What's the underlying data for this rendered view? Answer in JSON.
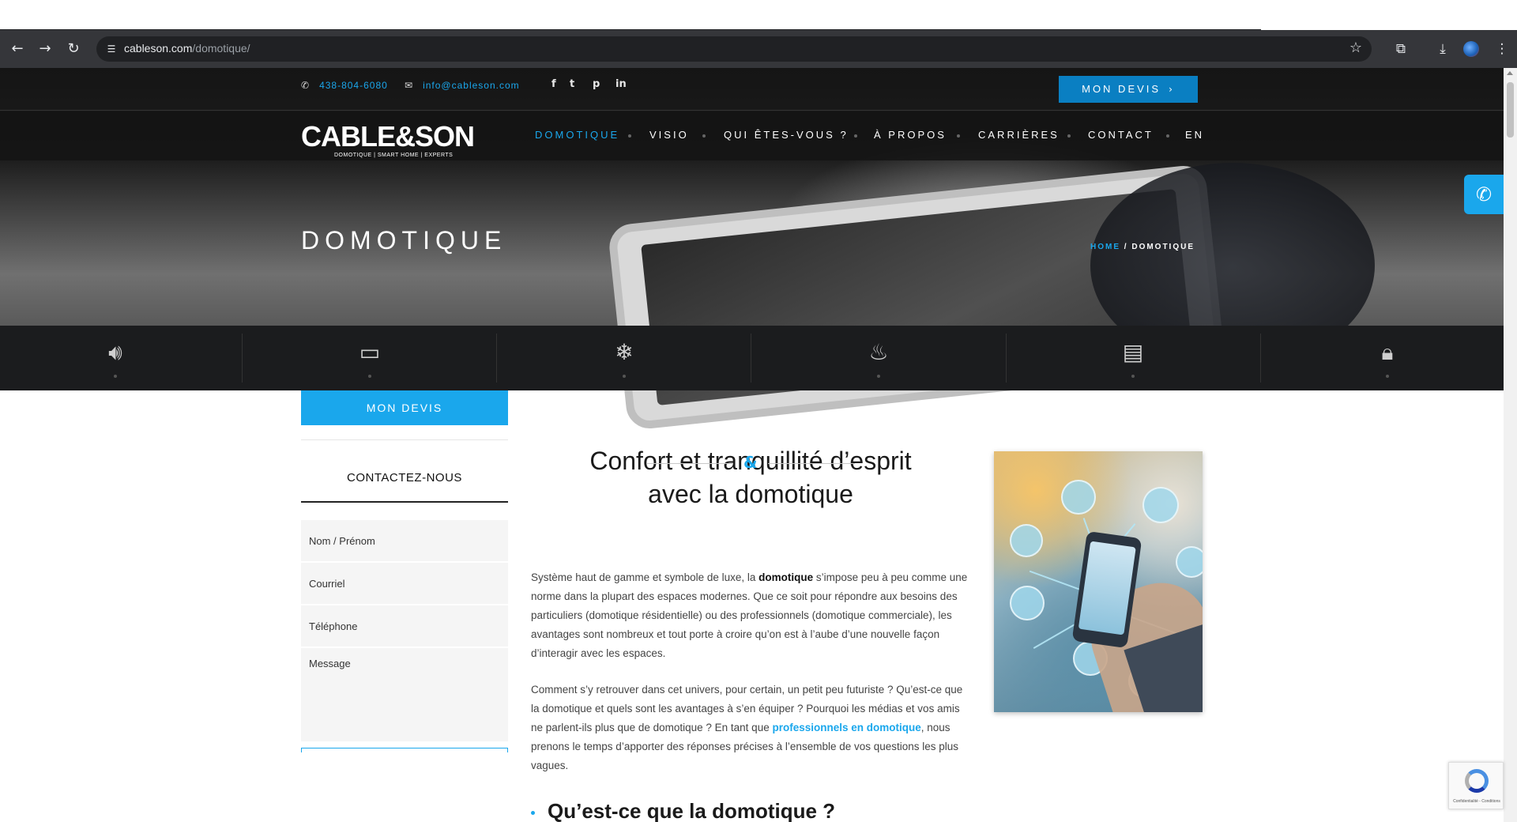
{
  "browser": {
    "url_host": "cableson.com",
    "url_path": "/domotique/"
  },
  "topbar": {
    "phone": "438-804-6080",
    "email": "info@cableson.com",
    "social": [
      "f",
      "t",
      "p",
      "in"
    ],
    "devis_label": "MON DEVIS"
  },
  "logo": {
    "wordmark": "CABLE&SON",
    "tagline": "DOMOTIQUE | SMART HOME | EXPERTS"
  },
  "nav": {
    "items": [
      {
        "label": "DOMOTIQUE",
        "active": true
      },
      {
        "label": "VISIO",
        "active": false
      },
      {
        "label": "QUI ÊTES-VOUS ?",
        "active": false
      },
      {
        "label": "À PROPOS",
        "active": false
      },
      {
        "label": "CARRIÈRES",
        "active": false
      },
      {
        "label": "CONTACT",
        "active": false
      },
      {
        "label": "EN",
        "active": false
      }
    ]
  },
  "hero": {
    "title": "DOMOTIQUE",
    "breadcrumb_home": "HOME",
    "breadcrumb_sep": " / ",
    "breadcrumb_current": "DOMOTIQUE"
  },
  "icons": [
    "speaker-icon",
    "monitor-icon",
    "snowflake-icon",
    "lightbulb-icon",
    "blinds-icon",
    "lock-icon"
  ],
  "sidebar": {
    "devis_label": "MON DEVIS",
    "contact_title": "CONTACTEZ-NOUS",
    "fields": {
      "name_placeholder": "Nom / Prénom",
      "email_placeholder": "Courriel",
      "phone_placeholder": "Téléphone",
      "message_placeholder": "Message"
    }
  },
  "content": {
    "heading_line1": "Confort et tranquillité d’esprit",
    "heading_line2": "avec la domotique",
    "amp": "&",
    "p1_a": "Système haut de gamme et symbole de luxe, la ",
    "p1_b": "domotique",
    "p1_c": " s’impose peu à peu comme une norme dans la plupart des espaces modernes. Que ce soit pour répondre aux besoins des particuliers (domotique résidentielle) ou des professionnels (domotique commerciale), les avantages sont nombreux et tout porte à croire qu’on est à l’aube d’une nouvelle façon d’interagir avec les espaces.",
    "p2_a": "Comment s’y retrouver dans cet univers, pour certain, un petit peu futuriste ? Qu’est-ce que la domotique et quels sont les avantages à s’en équiper ? Pourquoi les médias et vos amis ne parlent-ils plus que de domotique ? En tant que ",
    "p2_link": "professionnels en domotique",
    "p2_c": ", nous prenons le temps d’apporter des réponses précises à l’ensemble de vos questions les plus vagues.",
    "h2": "Qu’est-ce que la domotique ?"
  },
  "recaptcha": {
    "text": "Confidentialité - Conditions"
  },
  "colors": {
    "accent": "#1aa7ec",
    "dark": "#1b1c1e"
  }
}
